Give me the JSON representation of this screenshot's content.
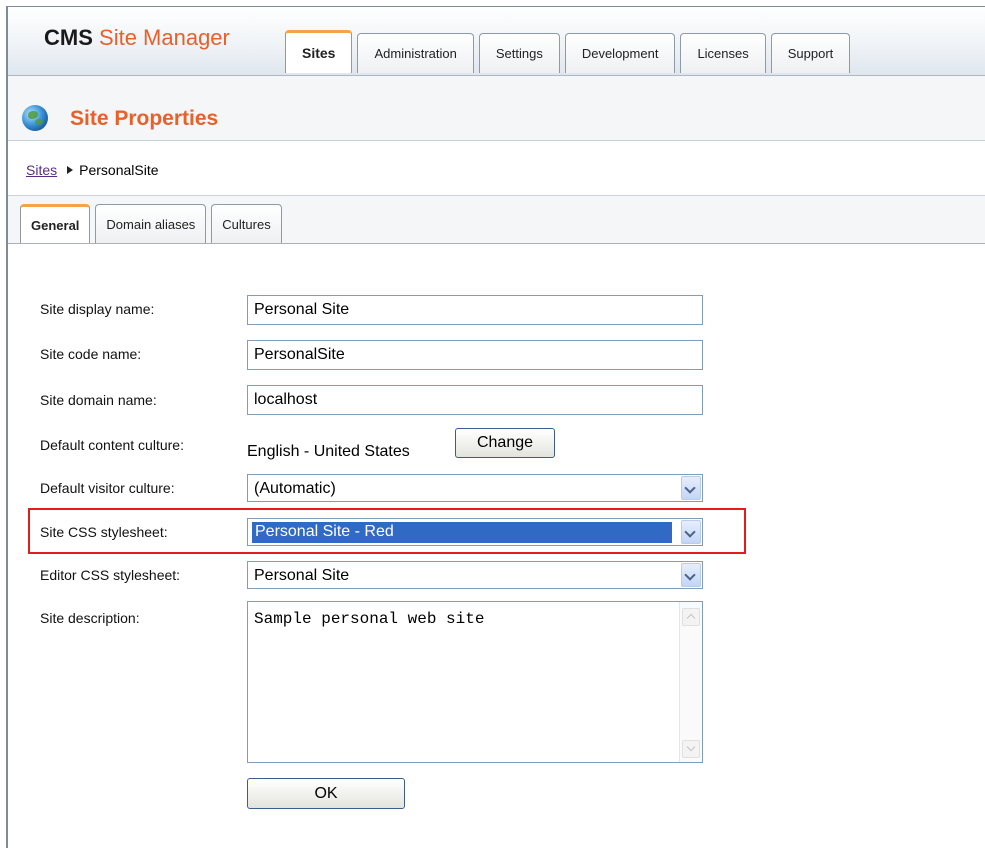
{
  "header": {
    "brand_cms": "CMS",
    "brand_name": "Site Manager",
    "tabs": [
      {
        "label": "Sites",
        "active": true
      },
      {
        "label": "Administration",
        "active": false
      },
      {
        "label": "Settings",
        "active": false
      },
      {
        "label": "Development",
        "active": false
      },
      {
        "label": "Licenses",
        "active": false
      },
      {
        "label": "Support",
        "active": false
      }
    ]
  },
  "page": {
    "title": "Site Properties",
    "icon": "globe-icon"
  },
  "breadcrumb": {
    "parent": "Sites",
    "current": "PersonalSite"
  },
  "subtabs": [
    {
      "label": "General",
      "active": true
    },
    {
      "label": "Domain aliases",
      "active": false
    },
    {
      "label": "Cultures",
      "active": false
    }
  ],
  "form": {
    "display_name_label": "Site display name:",
    "display_name_value": "Personal Site",
    "code_name_label": "Site code name:",
    "code_name_value": "PersonalSite",
    "domain_label": "Site domain name:",
    "domain_value": "localhost",
    "content_culture_label": "Default content culture:",
    "content_culture_value": "English - United States",
    "change_button": "Change",
    "visitor_culture_label": "Default visitor culture:",
    "visitor_culture_value": "(Automatic)",
    "site_css_label": "Site CSS stylesheet:",
    "site_css_value": "Personal Site - Red",
    "editor_css_label": "Editor CSS stylesheet:",
    "editor_css_value": "Personal Site",
    "description_label": "Site description:",
    "description_value": "Sample personal web site",
    "ok_button": "OK"
  },
  "colors": {
    "accent_orange": "#e8602a",
    "highlight_red": "#e31c1c",
    "selection_blue": "#316ac5"
  }
}
